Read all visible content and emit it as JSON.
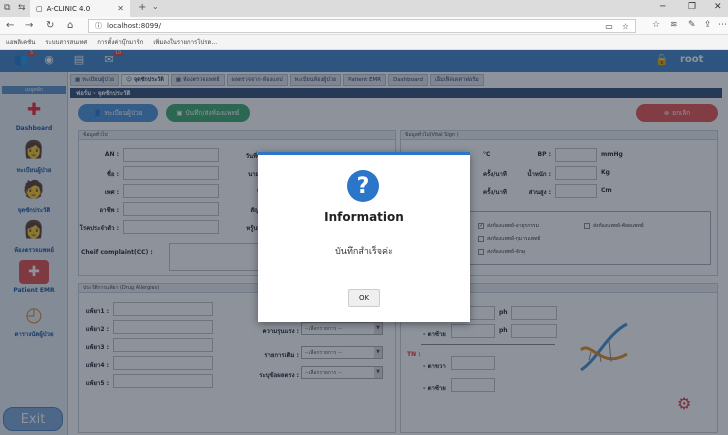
{
  "browser": {
    "tab_title": "A-CLINIC 4.0",
    "url": "localhost:8099/",
    "bookmarks": [
      "แอพลิเคชัน",
      "ระบบสารสนเทศ",
      "การตั้งค่าบุ๊กมาร์ก",
      "เพิ่มลงในรายการโปรด..."
    ]
  },
  "app": {
    "badges": {
      "users": "5",
      "mail": "10"
    },
    "user": "root",
    "sidebar_header": "เมนูหลัก",
    "sidebar": [
      {
        "label": "Dashboard",
        "icon": "plus-cross-icon"
      },
      {
        "label": "ทะเบียนผู้ป่วย",
        "icon": "nurse-icon"
      },
      {
        "label": "จุดซักประวัติ",
        "icon": "patient-icon"
      },
      {
        "label": "ห้องตรวจแพทย์",
        "icon": "doctor-icon"
      },
      {
        "label": "Patient EMR",
        "icon": "medical-record-icon"
      },
      {
        "label": "ตารางนัดผู้ป่วย",
        "icon": "clock-icon"
      }
    ],
    "exit_label": "Exit",
    "tabs": [
      "ทะเบียนผู้ป่วย",
      "จุดซักประวัติ",
      "ห้องตรวจแพทย์",
      "ผลตรวจจาก-ห้องแลป",
      "ทะเบียนห้องผู้ป่วย",
      "Patient EMR",
      "Dashboard",
      "เอ็มเฟิลเดตาฟอร์ม"
    ],
    "form_title": "ฟอร์ม - จุดซักประวัติ",
    "buttons": {
      "register": "ทะเบียนผู้ป่วย",
      "save_send": "บันทึก/ส่งห้องแพทย์",
      "cancel": "ยกเลิก"
    },
    "general_panel": {
      "title": "ข้อมูลทั่วไป",
      "fields": [
        "AN :",
        "ชื่อ :",
        "เพศ :",
        "อาชีพ :",
        "โรคประจำตัว :"
      ],
      "fields_right": [
        "วันที่ซักประ",
        "นามสกุล :",
        "ปีเกิด :",
        "สัญชาติ :",
        "หรู้บเลือด :"
      ],
      "cc_label": "Cheif complaint(CC) :"
    },
    "vital_panel": {
      "title": "ข้อมูลทั่วไป(Vital Sign )",
      "units": [
        "°C",
        "ครั้ง/นาที",
        "ครั้ง/นาที"
      ],
      "labels_right": [
        "BP :",
        "น้ำหนัก :",
        "ส่วนสูง :"
      ],
      "units_right": [
        "mmHg",
        "Kg",
        "Cm"
      ],
      "checks": [
        "ส่งห้องแพทย์-อายุรกรรม",
        "ส่งห้องแพทย์-ศัลยแพทย์",
        "ส่งห้องแพทย์-กุมารแพทย์",
        "ส่งห้องแพทย์-จักษุ"
      ]
    },
    "allergy_panel": {
      "title": "ประวัติการแพ้ยา (Drug Allergies)",
      "fields": [
        "แพ้ยา1 :",
        "แพ้ยา2 :",
        "แพ้ยา3 :",
        "แพ้ยา4 :",
        "แพ้ยา5 :"
      ],
      "mid_labels": [
        "สถ",
        "ความรุนแรง :",
        "รายการเดิม :",
        "ระบุข้อผลตรง :"
      ],
      "select_placeholder": "--เลือกรายการ --"
    },
    "bottom_right": {
      "ph_label": "ph",
      "tn_label": "TN :",
      "row_labels": [
        "- ตาซ้าย",
        "- ตาขวา",
        "- ตาซ้าย"
      ]
    },
    "dialog": {
      "title": "Information",
      "message": "บันทึกสำเร็จค่ะ",
      "ok": "OK"
    }
  }
}
